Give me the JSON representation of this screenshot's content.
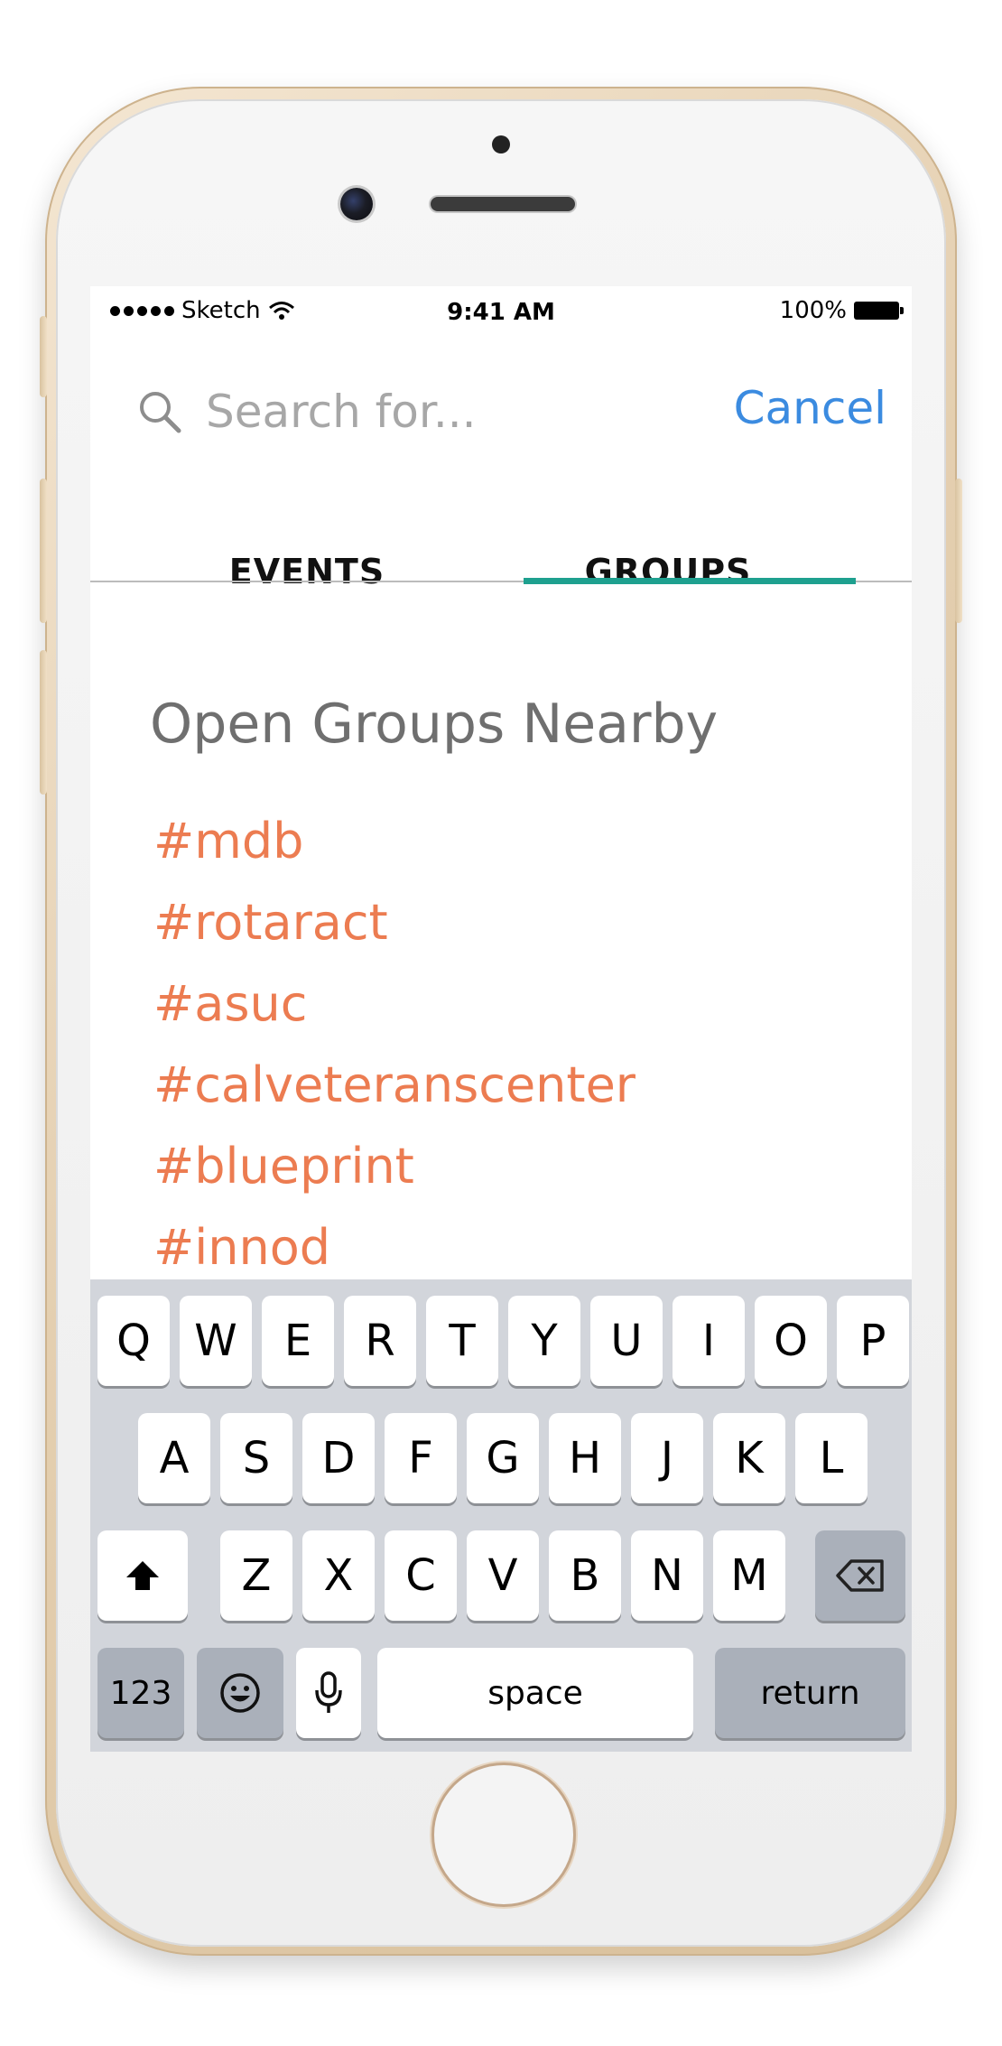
{
  "status_bar": {
    "carrier": "Sketch",
    "time": "9:41 AM",
    "battery": "100%"
  },
  "search": {
    "placeholder": "Search for...",
    "cancel_label": "Cancel"
  },
  "tabs": [
    {
      "label": "EVENTS",
      "active": false
    },
    {
      "label": "GROUPS",
      "active": true
    }
  ],
  "accent_color": "#1ea08f",
  "link_color": "#ec7c51",
  "section_title": "Open Groups Nearby",
  "groups": [
    "#mdb",
    "#rotaract",
    "#asuc",
    "#calveteranscenter",
    "#blueprint",
    "#innod"
  ],
  "keyboard": {
    "row1": [
      "Q",
      "W",
      "E",
      "R",
      "T",
      "Y",
      "U",
      "I",
      "O",
      "P"
    ],
    "row2": [
      "A",
      "S",
      "D",
      "F",
      "G",
      "H",
      "J",
      "K",
      "L"
    ],
    "row3": [
      "Z",
      "X",
      "C",
      "V",
      "B",
      "N",
      "M"
    ],
    "numbers_label": "123",
    "space_label": "space",
    "return_label": "return",
    "shift_icon": "shift-icon",
    "delete_icon": "backspace-icon",
    "emoji_icon": "emoji-icon",
    "mic_icon": "microphone-icon"
  }
}
